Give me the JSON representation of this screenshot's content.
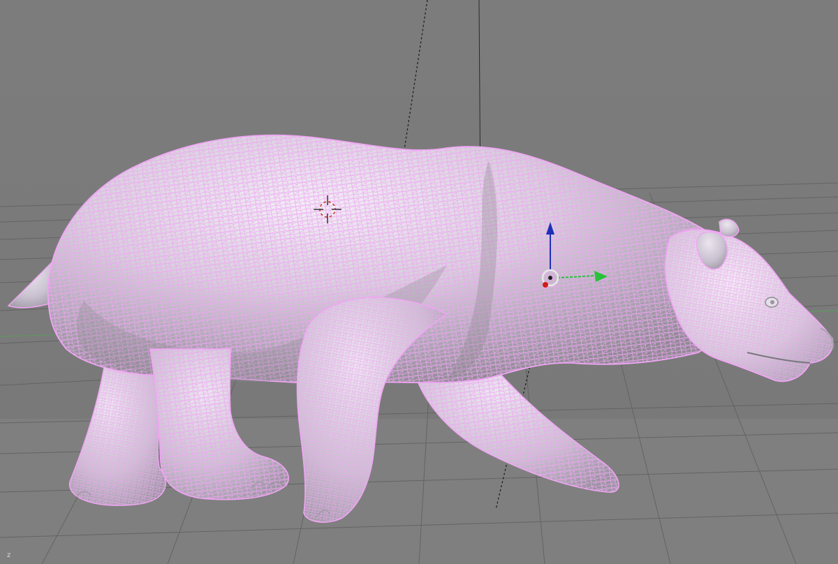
{
  "viewport": {
    "background_upper": "#7b7b7b",
    "background_lower": "#808080",
    "grid_color": "#5f5f5f",
    "x_axis_color": "#5a9e5a",
    "axis_indicator_label": "z"
  },
  "mesh": {
    "object": "bear",
    "display_mode": "solid-with-wireframe",
    "body_color": "#d8d0dc",
    "shade_color": "#8f8a93",
    "highlight_color": "#f3eef6",
    "wire_color": "#f0a6f4"
  },
  "cursor_3d": {
    "icon": "crosshair-icon",
    "colors": [
      "#c0392b",
      "#ffffff"
    ]
  },
  "gizmo": {
    "icon": "transform-gizmo-icon",
    "z_color": "#1f2fb8",
    "y_color": "#27c23a",
    "x_color": "#d01c1c"
  }
}
